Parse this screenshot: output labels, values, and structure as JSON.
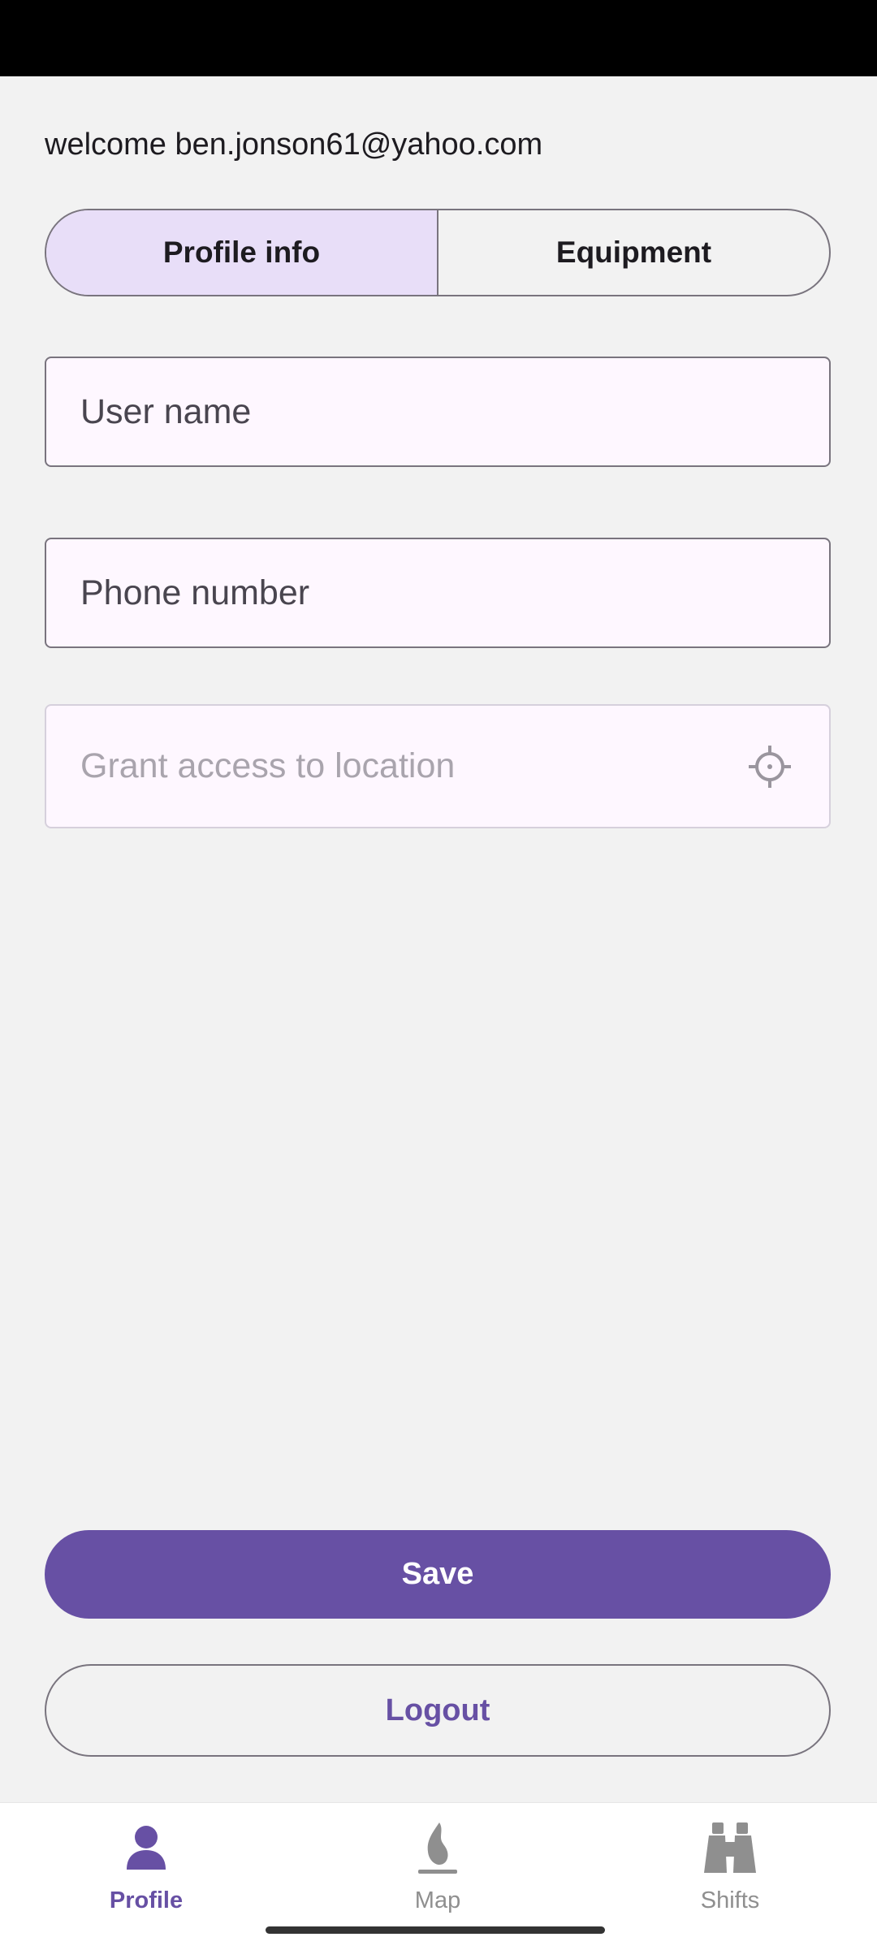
{
  "header": {
    "welcome_text": "welcome ben.jonson61@yahoo.com"
  },
  "tabs": [
    {
      "label": "Profile info",
      "selected": true
    },
    {
      "label": "Equipment",
      "selected": false
    }
  ],
  "form": {
    "username_placeholder": "User name",
    "phone_placeholder": "Phone number",
    "location_placeholder": "Grant access to location",
    "location_icon": "my-location-icon"
  },
  "actions": {
    "save_label": "Save",
    "logout_label": "Logout"
  },
  "bottom_nav": {
    "items": [
      {
        "label": "Profile",
        "icon": "person-icon",
        "active": true
      },
      {
        "label": "Map",
        "icon": "flame-icon",
        "active": false
      },
      {
        "label": "Shifts",
        "icon": "binoculars-icon",
        "active": false
      }
    ]
  },
  "colors": {
    "primary": "#6750a4",
    "segment_selected": "#e8def8",
    "field_background": "#fef7ff",
    "background": "#f2f2f2",
    "inactive_nav": "#8f8f8f"
  }
}
